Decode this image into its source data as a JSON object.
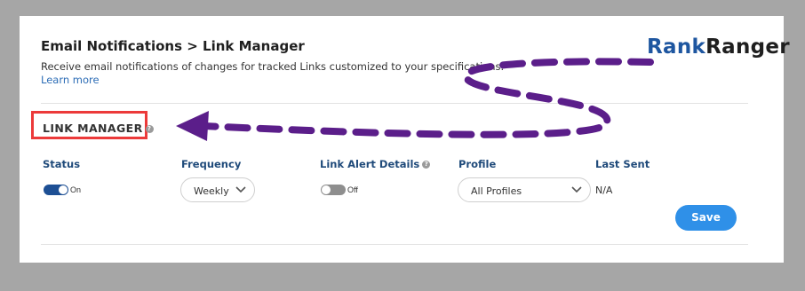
{
  "header": {
    "title": "Email Notifications > Link Manager",
    "description": "Receive email notifications of changes for tracked Links customized to your specifications.",
    "learn_more": "Learn more"
  },
  "logo": {
    "part1": "Rank",
    "part2": "Ranger"
  },
  "section": {
    "title": "LINK MANAGER",
    "help": "?"
  },
  "columns": {
    "status": "Status",
    "frequency": "Frequency",
    "link_alert_details": "Link Alert Details",
    "profile": "Profile",
    "last_sent": "Last Sent"
  },
  "row": {
    "status_toggle": "On",
    "frequency_value": "Weekly",
    "link_alert_toggle": "Off",
    "profile_value": "All Profiles",
    "last_sent_value": "N/A"
  },
  "actions": {
    "save": "Save"
  },
  "colors": {
    "highlight_box": "#ec3a3a",
    "arrow": "#5b1e8a",
    "save_button": "#2f90e8",
    "toggle_on": "#1d4f94"
  }
}
